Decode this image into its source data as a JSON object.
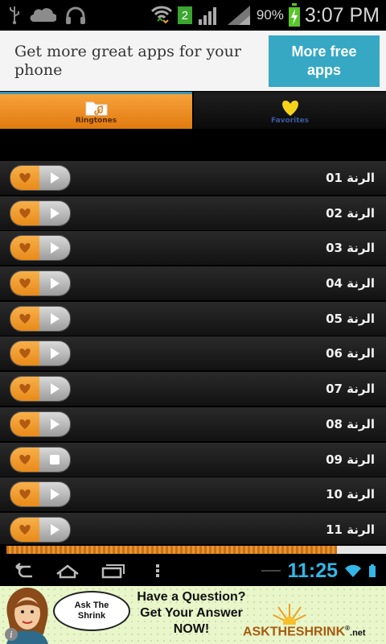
{
  "status_bar": {
    "notification_count": "2",
    "battery_percent": "90%",
    "time": "3:07 PM",
    "icons": [
      "usb-icon",
      "cloud-icon",
      "headphones-icon",
      "wifi-icon",
      "signal-icon",
      "battery-charging-icon"
    ]
  },
  "top_ad": {
    "text": "Get more great apps for your phone",
    "button_label": "More free\napps"
  },
  "tabs": [
    {
      "label": "Ringtones",
      "icon": "folder-music-icon",
      "selected": true
    },
    {
      "label": "Favorites",
      "icon": "heart-icon",
      "selected": false
    }
  ],
  "ringtones": [
    {
      "title": "الرنة 01",
      "state": "play"
    },
    {
      "title": "الرنة 02",
      "state": "play"
    },
    {
      "title": "الرنة 03",
      "state": "play"
    },
    {
      "title": "الرنة 04",
      "state": "play"
    },
    {
      "title": "الرنة 05",
      "state": "play"
    },
    {
      "title": "الرنة 06",
      "state": "play"
    },
    {
      "title": "الرنة 07",
      "state": "play"
    },
    {
      "title": "الرنة 08",
      "state": "play"
    },
    {
      "title": "الرنة 09",
      "state": "stop"
    },
    {
      "title": "الرنة 10",
      "state": "play"
    },
    {
      "title": "الرنة 11",
      "state": "play"
    }
  ],
  "playback": {
    "progress_fraction": 0.87
  },
  "nav_bar": {
    "time": "11:25",
    "icons": [
      "back-icon",
      "home-icon",
      "recent-apps-icon",
      "menu-dots-icon"
    ]
  },
  "bottom_ad": {
    "bubble": "Ask The\nShrink",
    "headline": "Have a Question?\nGet Your Answer\nNOW!",
    "brand": "ASKTHESHRINK",
    "brand_suffix": ".net",
    "registered": "®"
  },
  "colors": {
    "accent_orange": "#f0932b",
    "tab_blue": "#3d94b8",
    "nav_time_blue": "#33b5e5",
    "ad_button": "#36a8c4"
  }
}
